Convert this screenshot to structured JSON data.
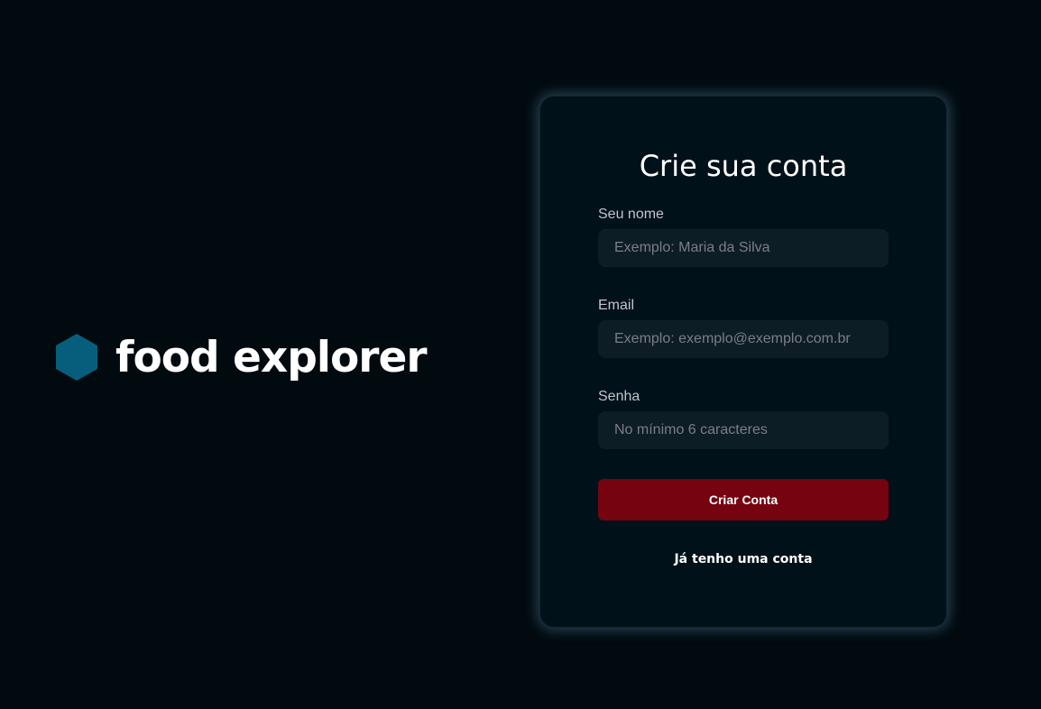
{
  "brand": {
    "name": "food explorer",
    "icon": "hexagon-logo-icon",
    "icon_color": "#065e7c"
  },
  "signup": {
    "title": "Crie sua conta",
    "fields": [
      {
        "label": "Seu nome",
        "value": "",
        "placeholder": "Exemplo: Maria da Silva"
      },
      {
        "label": "Email",
        "value": "",
        "placeholder": "Exemplo: exemplo@exemplo.com.br"
      },
      {
        "label": "Senha",
        "value": "",
        "placeholder": "No mínimo 6 caracteres"
      }
    ],
    "submit_label": "Criar Conta",
    "login_link": "Já tenho uma conta"
  },
  "colors": {
    "background": "#000a0f",
    "card": "#001119",
    "input": "#0d1d25",
    "button": "#750310",
    "accent": "#065e7c"
  }
}
